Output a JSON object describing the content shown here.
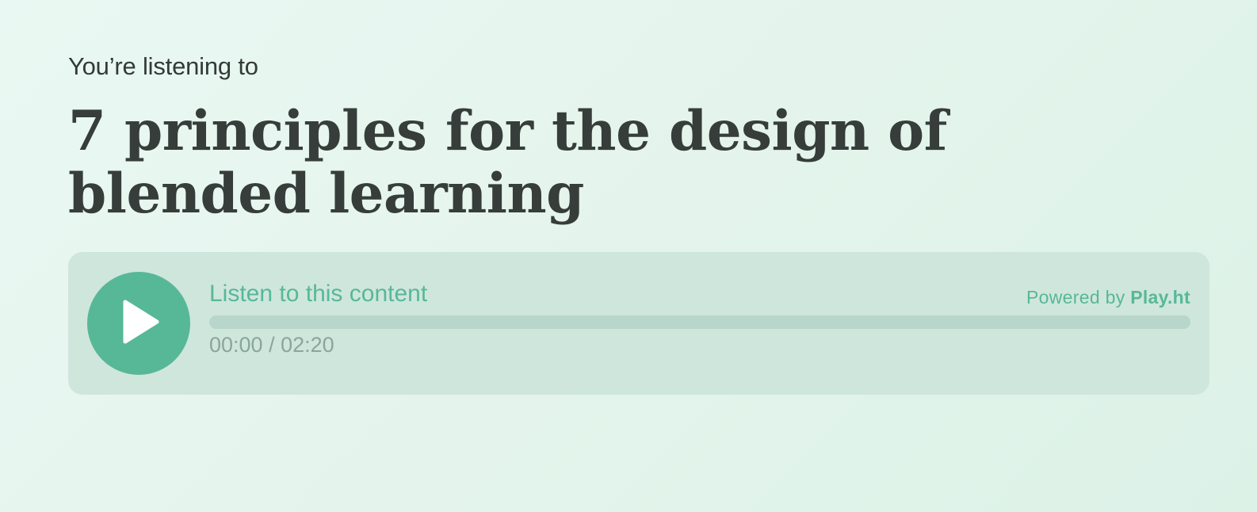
{
  "header": {
    "eyebrow": "You’re listening to",
    "title": "7 principles for the design of blended learning"
  },
  "player": {
    "listen_label": "Listen to this content",
    "powered_prefix": "Powered by ",
    "powered_brand": "Play.ht",
    "time_display": "00:00 / 02:20",
    "progress_fraction": 0,
    "play_icon": "play-icon",
    "colors": {
      "accent": "#57b898",
      "panel": "#cfe6dd",
      "track": "#b8d6cb",
      "time_text": "#8aa59b",
      "title_text": "#363d3a"
    }
  }
}
